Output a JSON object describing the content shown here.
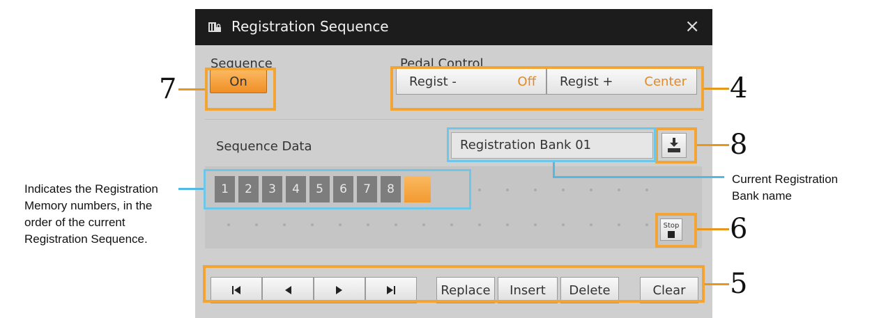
{
  "window": {
    "title": "Registration Sequence",
    "close_glyph": "×"
  },
  "sequence": {
    "label": "Sequence",
    "toggle_value": "On"
  },
  "pedal_control": {
    "label": "Pedal Control",
    "items": [
      {
        "name": "Regist -",
        "value": "Off"
      },
      {
        "name": "Regist +",
        "value": "Center"
      }
    ]
  },
  "sequence_data": {
    "label": "Sequence Data",
    "bank_name": "Registration Bank 01",
    "memory_numbers": [
      "1",
      "2",
      "3",
      "4",
      "5",
      "6",
      "7",
      "8"
    ],
    "stop_label": "Stop"
  },
  "nav": {
    "first_icon": "skip-to-first-icon",
    "prev_icon": "left-arrow-icon",
    "next_icon": "right-arrow-icon",
    "last_icon": "skip-to-last-icon"
  },
  "actions": {
    "replace": "Replace",
    "insert": "Insert",
    "delete": "Delete",
    "clear": "Clear"
  },
  "callouts": {
    "c4": "4",
    "c5": "5",
    "c6": "6",
    "c7": "7",
    "c8": "8"
  },
  "annotations": {
    "memory_note": [
      "Indicates the Registration",
      "Memory numbers, in the",
      "order of the current",
      "Registration Sequence."
    ],
    "bank_note": [
      "Current Registration",
      "Bank name"
    ]
  },
  "colors": {
    "highlight_orange": "#f2a434",
    "highlight_blue": "#6ec6e8",
    "value_orange": "#e0892a",
    "title_bar": "#1c1c1c"
  }
}
